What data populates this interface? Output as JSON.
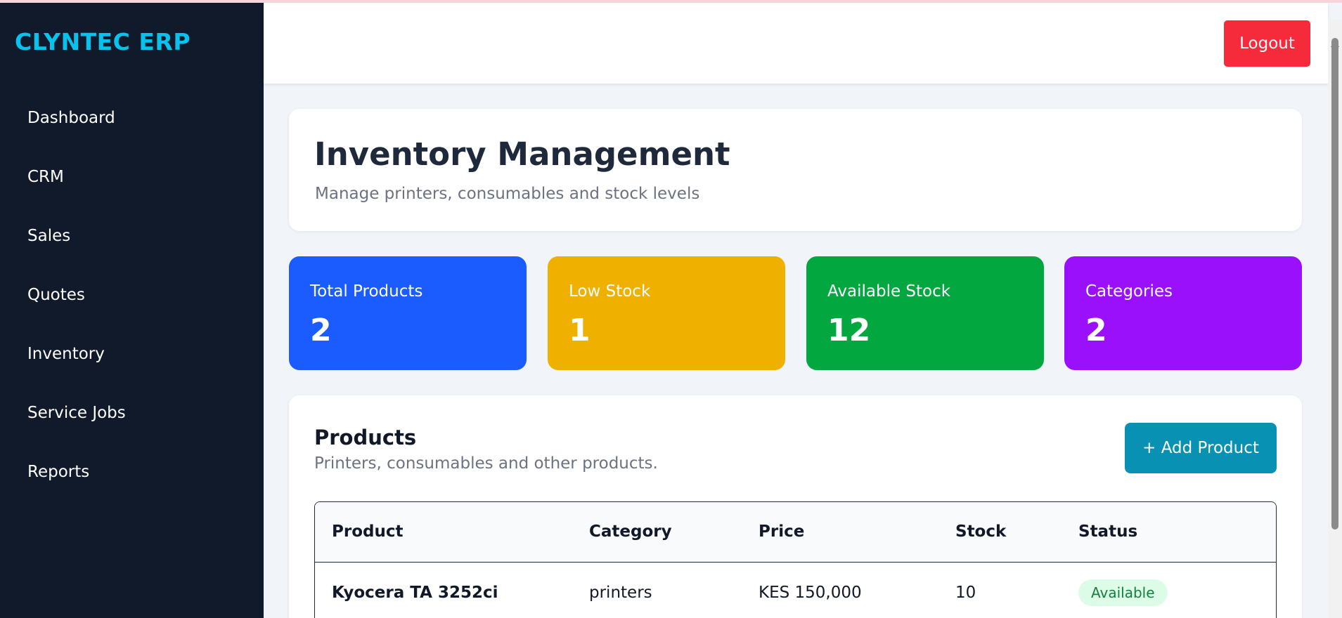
{
  "brand": "CLYNTEC ERP",
  "sidebar": {
    "items": [
      {
        "label": "Dashboard"
      },
      {
        "label": "CRM"
      },
      {
        "label": "Sales"
      },
      {
        "label": "Quotes"
      },
      {
        "label": "Inventory"
      },
      {
        "label": "Service Jobs"
      },
      {
        "label": "Reports"
      }
    ]
  },
  "topbar": {
    "logout_label": "Logout"
  },
  "header": {
    "title": "Inventory Management",
    "subtitle": "Manage printers, consumables and stock levels"
  },
  "stats": [
    {
      "label": "Total Products",
      "value": "2",
      "color": "#1a5cff"
    },
    {
      "label": "Low Stock",
      "value": "1",
      "color": "#efb000"
    },
    {
      "label": "Available Stock",
      "value": "12",
      "color": "#02a83f"
    },
    {
      "label": "Categories",
      "value": "2",
      "color": "#9b10fb"
    }
  ],
  "products": {
    "title": "Products",
    "subtitle": "Printers, consumables and other products.",
    "add_label": "+ Add Product",
    "columns": [
      "Product",
      "Category",
      "Price",
      "Stock",
      "Status"
    ],
    "rows": [
      {
        "product": "Kyocera TA 3252ci",
        "category": "printers",
        "price": "KES 150,000",
        "stock": "10",
        "status": "Available"
      }
    ]
  }
}
